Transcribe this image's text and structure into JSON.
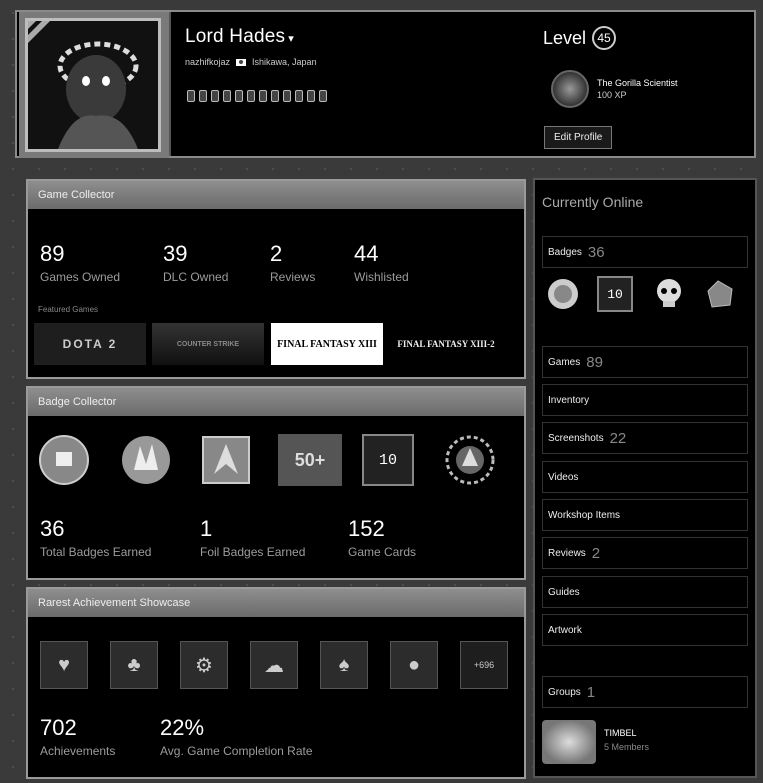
{
  "header": {
    "persona_name": "Lord Hades",
    "dropdown_glyph": "▾",
    "real_name": "nazhifkojaz",
    "location": "Ishikawa, Japan",
    "level_label": "Level",
    "level": "45",
    "favorite_badge": {
      "name": "The Gorilla Scientist",
      "xp": "100 XP"
    },
    "edit_profile": "Edit Profile"
  },
  "game_collector": {
    "title": "Game Collector",
    "stats": [
      {
        "value": "89",
        "label": "Games Owned"
      },
      {
        "value": "39",
        "label": "DLC Owned"
      },
      {
        "value": "2",
        "label": "Reviews"
      },
      {
        "value": "44",
        "label": "Wishlisted"
      }
    ],
    "featured_label": "Featured Games",
    "featured": [
      "DOTA 2",
      "COUNTER STRIKE",
      "FINAL FANTASY XIII",
      "FINAL FANTASY XIII-2"
    ]
  },
  "badge_collector": {
    "title": "Badge Collector",
    "badge_texts": [
      "50+",
      "10"
    ],
    "stats": [
      {
        "value": "36",
        "label": "Total Badges Earned"
      },
      {
        "value": "1",
        "label": "Foil Badges Earned"
      },
      {
        "value": "152",
        "label": "Game Cards"
      }
    ]
  },
  "achievements": {
    "title": "Rarest Achievement Showcase",
    "more": "+696",
    "stats": [
      {
        "value": "702",
        "label": "Achievements"
      },
      {
        "value": "22%",
        "label": "Avg. Game Completion Rate"
      }
    ]
  },
  "sidebar": {
    "status": "Currently Online",
    "badges": {
      "label": "Badges",
      "count": "36",
      "tile_text": "10"
    },
    "items": [
      {
        "label": "Games",
        "count": "89"
      },
      {
        "label": "Inventory",
        "count": ""
      },
      {
        "label": "Screenshots",
        "count": "22"
      },
      {
        "label": "Videos",
        "count": ""
      },
      {
        "label": "Workshop Items",
        "count": ""
      },
      {
        "label": "Reviews",
        "count": "2"
      },
      {
        "label": "Guides",
        "count": ""
      },
      {
        "label": "Artwork",
        "count": ""
      }
    ],
    "groups": {
      "label": "Groups",
      "count": "1"
    },
    "group": {
      "name": "TIMBEL",
      "members": "5 Members"
    }
  }
}
